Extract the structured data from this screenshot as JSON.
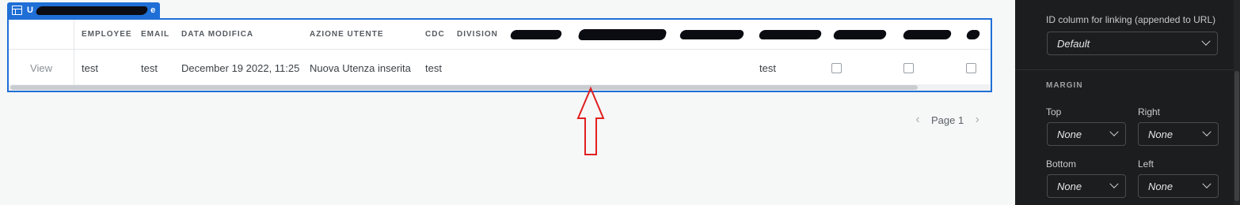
{
  "component": {
    "tag_label": "U",
    "tag_suffix": "e"
  },
  "table": {
    "columns": [
      {
        "key": "view",
        "label": ""
      },
      {
        "key": "employee",
        "label": "EMPLOYEE"
      },
      {
        "key": "email",
        "label": "EMAIL"
      },
      {
        "key": "data_modifica",
        "label": "DATA MODIFICA"
      },
      {
        "key": "azione_utente",
        "label": "AZIONE UTENTE"
      },
      {
        "key": "cdc",
        "label": "CDC"
      },
      {
        "key": "division",
        "label": "DIVISION"
      }
    ],
    "row": {
      "view": "View",
      "employee": "test",
      "email": "test",
      "data_modifica": "December 19 2022, 11:25",
      "azione_utente": "Nuova Utenza inserita",
      "cdc": "test",
      "hidden_col_value": "test"
    }
  },
  "pagination": {
    "page_label": "Page 1",
    "prev_icon": "chevron-left-icon",
    "next_icon": "chevron-right-icon"
  },
  "panel": {
    "id_column_label": "ID column for linking (appended to URL)",
    "id_column_value": "Default",
    "margin_section": "MARGIN",
    "top_label": "Top",
    "top_value": "None",
    "right_label": "Right",
    "right_value": "None",
    "bottom_label": "Bottom",
    "bottom_value": "None",
    "left_label": "Left",
    "left_value": "None"
  },
  "colors": {
    "accent": "#1f6fd6",
    "annotation": "#e02020",
    "panel_bg": "#1c1d1e"
  }
}
